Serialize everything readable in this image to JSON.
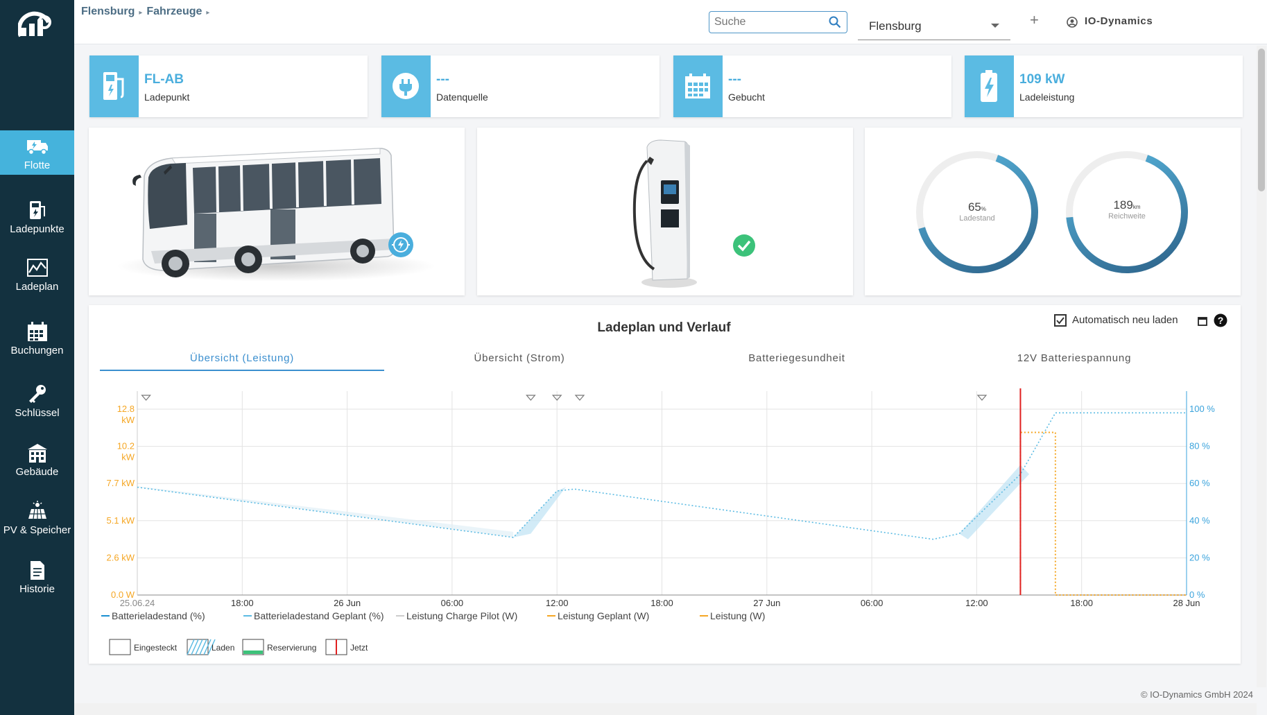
{
  "sidebar": {
    "items": [
      {
        "label": "Flotte",
        "icon": "truck-icon",
        "active": true
      },
      {
        "label": "Ladepunkte",
        "icon": "charger-icon",
        "active": false
      },
      {
        "label": "Ladeplan",
        "icon": "chart-icon",
        "active": false
      },
      {
        "label": "Buchungen",
        "icon": "calendar-icon",
        "active": false
      },
      {
        "label": "Schlüssel",
        "icon": "key-icon",
        "active": false
      },
      {
        "label": "Gebäude",
        "icon": "building-icon",
        "active": false
      },
      {
        "label": "PV & Speicher",
        "icon": "solar-icon",
        "active": false
      },
      {
        "label": "Historie",
        "icon": "document-icon",
        "active": false
      }
    ]
  },
  "header": {
    "breadcrumb": [
      "Flensburg",
      "Fahrzeuge"
    ],
    "search_placeholder": "Suche",
    "location": "Flensburg",
    "plus": "+",
    "user": "IO-Dynamics"
  },
  "kpis": [
    {
      "value": "FL-AB",
      "label": "Ladepunkt",
      "icon": "fuel-pump-icon"
    },
    {
      "value": "---",
      "label": "Datenquelle",
      "icon": "plug-icon"
    },
    {
      "value": "---",
      "label": "Gebucht",
      "icon": "calendar-grid-icon"
    },
    {
      "value": "109 kW",
      "label": "Ladeleistung",
      "icon": "battery-bolt-icon"
    }
  ],
  "gauges": [
    {
      "value": "65",
      "unit": "%",
      "label": "Ladestand",
      "fraction": 0.65
    },
    {
      "value": "189",
      "unit": "km",
      "label": "Reichweite",
      "fraction": 0.68
    }
  ],
  "colors": {
    "accent": "#5bbbe3",
    "sidebar": "#13313f",
    "orange": "#f5a623",
    "now": "#e02020",
    "check": "#3cc27a"
  },
  "chart_panel": {
    "title": "Ladeplan und Verlauf",
    "auto_reload_label": "Automatisch neu laden",
    "auto_reload_checked": true,
    "tabs": [
      "Übersicht (Leistung)",
      "Übersicht (Strom)",
      "Batteriegesundheit",
      "12V Batteriespannung"
    ]
  },
  "chart_data": {
    "type": "line",
    "x_ticks": [
      "25.06.24",
      "18:00",
      "26 Jun",
      "06:00",
      "12:00",
      "18:00",
      "27 Jun",
      "06:00",
      "12:00",
      "18:00",
      "28 Jun"
    ],
    "y_left_ticks": [
      "0.0 W",
      "2.6 kW",
      "5.1 kW",
      "7.7 kW",
      "10.2 kW",
      "12.8 kW"
    ],
    "y_right_ticks": [
      "0 %",
      "20 %",
      "40 %",
      "60 %",
      "80 %",
      "100 %"
    ],
    "x_range_hours": [
      12,
      72
    ],
    "y_right_range": [
      0,
      100
    ],
    "y_left_range": [
      0,
      12.8
    ],
    "series": [
      {
        "name": "Batterieladestand (%)",
        "color": "#1a8fd1",
        "points": []
      },
      {
        "name": "Batterieladestand Geplant (%)",
        "color": "#5bbbe3",
        "style": "dotted",
        "points": [
          [
            12,
            58
          ],
          [
            33.5,
            31
          ],
          [
            36,
            56
          ],
          [
            37,
            57
          ],
          [
            57.5,
            30
          ],
          [
            59,
            33
          ],
          [
            62.5,
            65
          ],
          [
            64.5,
            98
          ],
          [
            72,
            98
          ]
        ]
      },
      {
        "name": "Leistung Charge Pilot (W)",
        "color": "#cccccc",
        "points": []
      },
      {
        "name": "Leistung Geplant (W)",
        "color": "#f5a623",
        "style": "dotted",
        "points": [
          [
            62.5,
            0
          ],
          [
            62.5,
            11.2
          ],
          [
            64.5,
            11.2
          ],
          [
            64.5,
            0
          ],
          [
            72,
            0
          ]
        ]
      },
      {
        "name": "Leistung (W)",
        "color": "#f5a623",
        "points": []
      }
    ],
    "now_hours": 62.5,
    "markers_hours": [
      12.5,
      34.5,
      36,
      37.3,
      60.3
    ],
    "legend_shapes": [
      {
        "label": "Eingesteckt",
        "kind": "plugged"
      },
      {
        "label": "Laden",
        "kind": "charging"
      },
      {
        "label": "Reservierung",
        "kind": "reservation"
      },
      {
        "label": "Jetzt",
        "kind": "now"
      }
    ],
    "grid": true
  },
  "footer": {
    "copyright": "© IO-Dynamics GmbH 2024"
  }
}
